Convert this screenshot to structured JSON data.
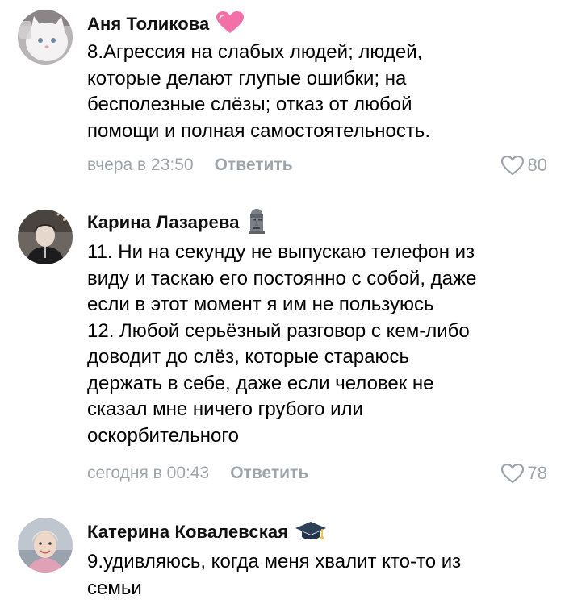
{
  "comments": [
    {
      "author": "Аня Толикова",
      "badge_icon": "pink-heart",
      "text": "8.Агрессия на слабых людей; людей,\nкоторые делают глупые ошибки; на\nбесполезные слёзы; отказ от любой\nпомощи и полная самостоятельность.",
      "time": "вчера в 23:50",
      "reply": "Ответить",
      "likes": "80"
    },
    {
      "author": "Карина Лазарева",
      "badge_icon": "moai",
      "text": "11. Ни на секунду не выпускаю телефон из\nвиду и таскаю его постоянно с собой, даже\nесли в этот момент я им не пользуюсь\n12. Любой серьёзный разговор с кем-либо\nдоводит до слёз, которые стараюсь\nдержать в себе, даже если человек не\nсказал мне ничего грубого или\nоскорбительного",
      "time": "сегодня в 00:43",
      "reply": "Ответить",
      "likes": "78"
    },
    {
      "author": "Катерина Ковалевская",
      "badge_icon": "graduation-cap",
      "text": "9.удивляюсь, когда меня хвалит кто-то из\nсемьи"
    }
  ],
  "colors": {
    "meta_gray": "#9ea4ab",
    "heart_pink": "#f26fa8"
  }
}
